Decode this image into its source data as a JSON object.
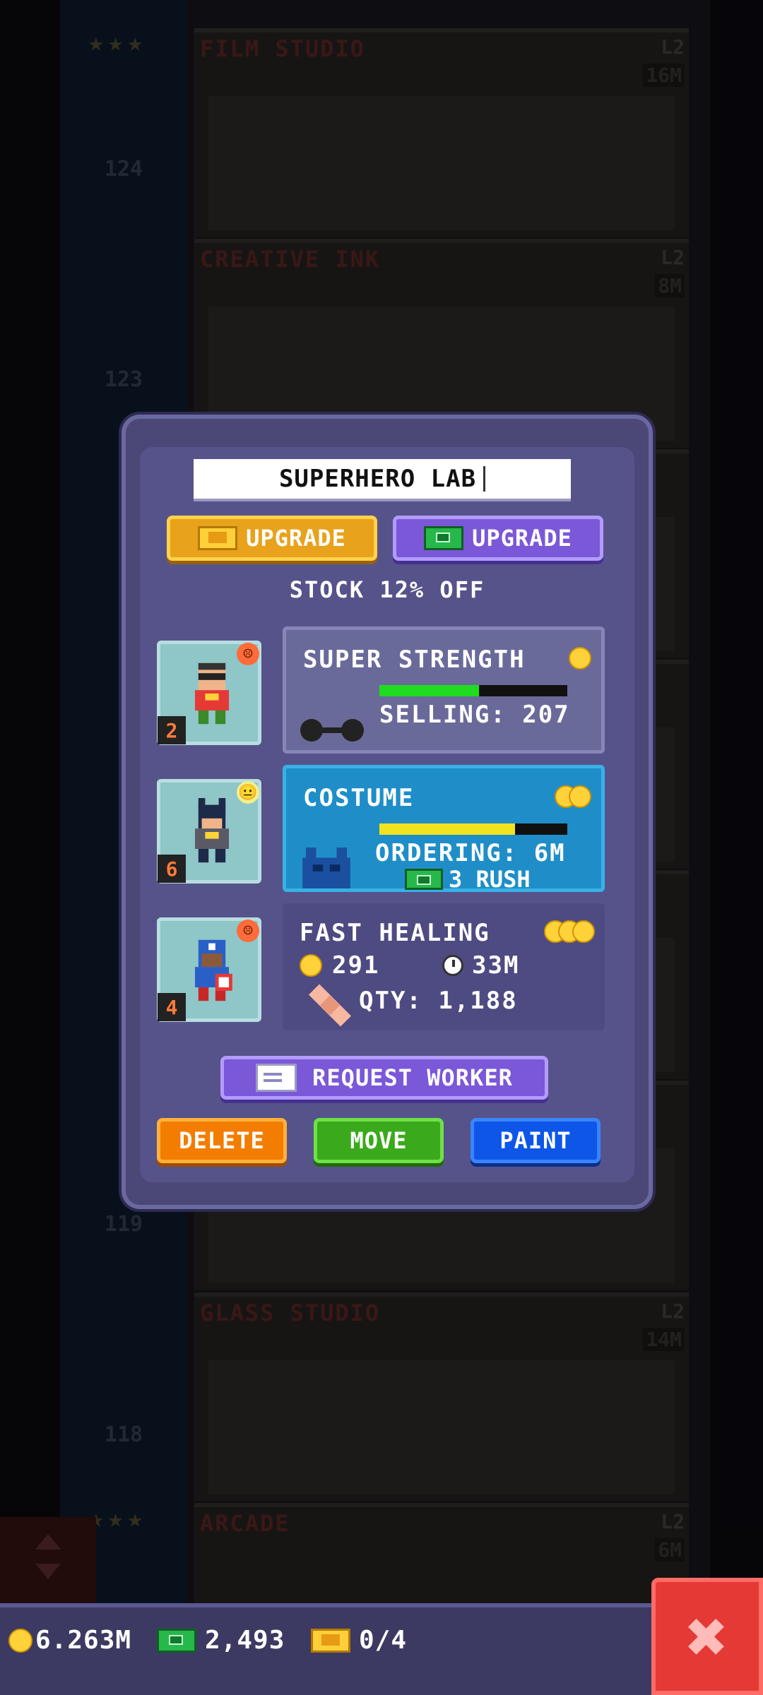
{
  "tower": {
    "floors": [
      {
        "number": "124",
        "title": "FILM STUDIO",
        "level": "L2",
        "tag": "16M"
      },
      {
        "number": "123",
        "title": "CREATIVE INK",
        "level": "L2",
        "tag": "8M"
      },
      {
        "number": "119",
        "title": "",
        "level": "",
        "tag": ""
      },
      {
        "number": "118",
        "title": "GLASS STUDIO",
        "level": "L2",
        "tag": "14M"
      },
      {
        "number": "",
        "title": "ARCADE",
        "level": "L2",
        "tag": "6M"
      }
    ]
  },
  "dialog": {
    "name": "SUPERHERO LAB",
    "upgrade_gold_label": "UPGRADE",
    "upgrade_bux_label": "UPGRADE",
    "subtitle": "STOCK 12% OFF",
    "workers": [
      {
        "level": "2",
        "mood": "unhappy"
      },
      {
        "level": "6",
        "mood": "neutral"
      },
      {
        "level": "4",
        "mood": "unhappy"
      }
    ],
    "items": [
      {
        "name": "SUPER STRENGTH",
        "status": "SELLING: 207",
        "progress": 0.53,
        "bar_color": "#1fdc1f",
        "coins": 1
      },
      {
        "name": "COSTUME",
        "status": "ORDERING: 6M",
        "rush": "3 RUSH",
        "progress": 0.72,
        "bar_color": "#f2e320",
        "coins": 2
      },
      {
        "name": "FAST HEALING",
        "cost": "291",
        "time": "33M",
        "qty": "QTY: 1,188",
        "coins": 3
      }
    ],
    "request_worker_label": "REQUEST WORKER",
    "delete_label": "DELETE",
    "move_label": "MOVE",
    "paint_label": "PAINT"
  },
  "bottom_bar": {
    "coins": "6.263M",
    "bux": "2,493",
    "vip": "0/4"
  },
  "colors": {
    "dialog_bg": "#4b4878",
    "gold_button": "#e8a21c",
    "purple_button": "#7a58d8",
    "delete": "#f27d00",
    "move": "#3aaa1c",
    "paint": "#0d56e8",
    "close": "#e53935"
  },
  "icons": [
    "coin-icon",
    "bux-icon",
    "vip-ticket-icon",
    "clock-icon",
    "dumbbell-icon",
    "mask-icon",
    "bandage-icon",
    "letter-icon",
    "close-icon"
  ]
}
